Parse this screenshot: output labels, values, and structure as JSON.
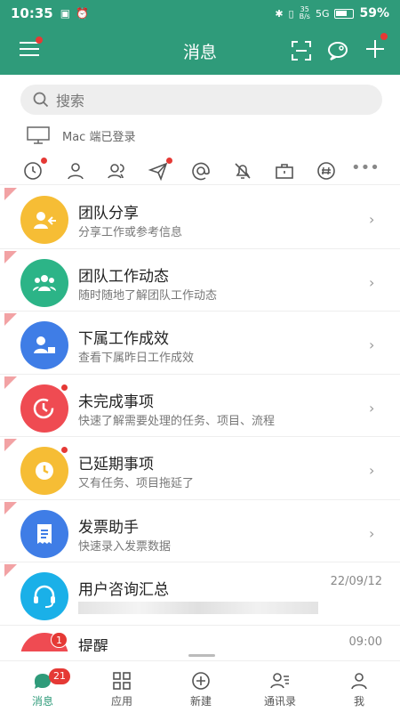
{
  "status": {
    "time": "10:35",
    "net_top": "35",
    "net_bottom": "B/s",
    "signal": "5G",
    "battery": "59%"
  },
  "header": {
    "title": "消息"
  },
  "search": {
    "placeholder": "搜索"
  },
  "login_notice": "Mac 端已登录",
  "list": [
    {
      "name": "团队分享",
      "desc": "分享工作或参考信息",
      "color": "#f6bd35",
      "icon": "share-icon",
      "dot": false
    },
    {
      "name": "团队工作动态",
      "desc": "随时随地了解团队工作动态",
      "color": "#2cb487",
      "icon": "team-icon",
      "dot": false
    },
    {
      "name": "下属工作成效",
      "desc": "查看下属昨日工作成效",
      "color": "#3f7de6",
      "icon": "report-icon",
      "dot": false
    },
    {
      "name": "未完成事项",
      "desc": "快速了解需要处理的任务、项目、流程",
      "color": "#ef4b52",
      "icon": "clock-icon",
      "dot": true
    },
    {
      "name": "已延期事项",
      "desc": "又有任务、项目拖延了",
      "color": "#f6bd35",
      "icon": "clock-icon",
      "dot": true
    },
    {
      "name": "发票助手",
      "desc": "快速录入发票数据",
      "color": "#3f7de6",
      "icon": "invoice-icon",
      "dot": false
    },
    {
      "name": "用户咨询汇总",
      "date": "22/09/12",
      "color": "#1ab0e8",
      "icon": "headset-icon",
      "dot": false
    }
  ],
  "partial_item": {
    "name": "提醒",
    "time": "09:00",
    "badge": "1"
  },
  "tabs": [
    {
      "label": "消息",
      "badge": "21",
      "active": true
    },
    {
      "label": "应用"
    },
    {
      "label": "新建"
    },
    {
      "label": "通讯录"
    },
    {
      "label": "我"
    }
  ],
  "colors": {
    "brand": "#2f9b7a",
    "alert": "#e53935"
  }
}
